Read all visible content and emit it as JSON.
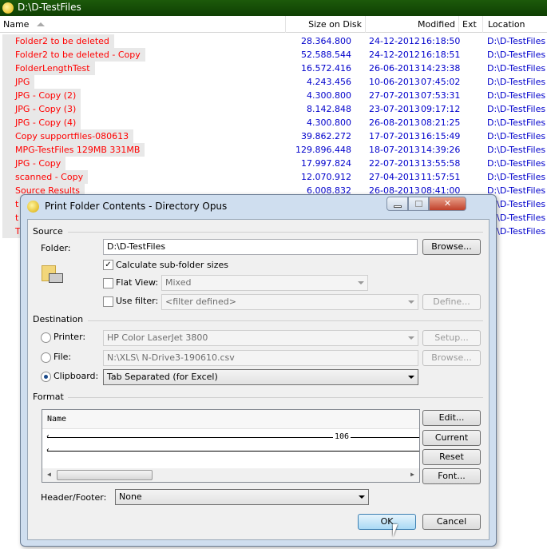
{
  "window": {
    "title": "D:\\D-TestFiles"
  },
  "columns": {
    "name": "Name",
    "size": "Size on Disk",
    "modified": "Modified",
    "ext": "Ext",
    "location": "Location"
  },
  "rows": [
    {
      "name": "Folder2 to be deleted",
      "size": "28.364.800",
      "date": "24-12-2012",
      "time": "16:18:50",
      "location": "D:\\D-TestFiles"
    },
    {
      "name": "Folder2 to be deleted - Copy",
      "size": "52.588.544",
      "date": "24-12-2012",
      "time": "16:18:51",
      "location": "D:\\D-TestFiles"
    },
    {
      "name": "FolderLengthTest",
      "size": "16.572.416",
      "date": "26-06-2013",
      "time": "14:23:38",
      "location": "D:\\D-TestFiles"
    },
    {
      "name": "JPG",
      "size": "4.243.456",
      "date": "10-06-2013",
      "time": "07:45:02",
      "location": "D:\\D-TestFiles"
    },
    {
      "name": "JPG - Copy (2)",
      "size": "4.300.800",
      "date": "27-07-2013",
      "time": "07:53:31",
      "location": "D:\\D-TestFiles"
    },
    {
      "name": "JPG - Copy (3)",
      "size": "8.142.848",
      "date": "23-07-2013",
      "time": "09:17:12",
      "location": "D:\\D-TestFiles"
    },
    {
      "name": "JPG - Copy (4)",
      "size": "4.300.800",
      "date": "26-08-2013",
      "time": "08:21:25",
      "location": "D:\\D-TestFiles"
    },
    {
      "name": "Copy supportfiles-080613",
      "size": "39.862.272",
      "date": "17-07-2013",
      "time": "16:15:49",
      "location": "D:\\D-TestFiles"
    },
    {
      "name": "MPG-TestFiles 129MB 331MB",
      "size": "129.896.448",
      "date": "18-07-2013",
      "time": "14:39:26",
      "location": "D:\\D-TestFiles"
    },
    {
      "name": "JPG - Copy",
      "size": "17.997.824",
      "date": "22-07-2013",
      "time": "13:55:58",
      "location": "D:\\D-TestFiles"
    },
    {
      "name": "scanned - Copy",
      "size": "12.070.912",
      "date": "27-04-2013",
      "time": "11:57:51",
      "location": "D:\\D-TestFiles"
    },
    {
      "name": "Source Results",
      "size": "6.008.832",
      "date": "26-08-2013",
      "time": "08:41:00",
      "location": "D:\\D-TestFiles"
    },
    {
      "name": "t",
      "size": "",
      "date": "",
      "time": "",
      "location": "D:\\D-TestFiles"
    },
    {
      "name": "t",
      "size": "",
      "date": "",
      "time": "",
      "location": "D:\\D-TestFiles"
    },
    {
      "name": "T",
      "size": "",
      "date": "",
      "time": "",
      "location": "D:\\D-TestFiles"
    }
  ],
  "dialog": {
    "title": "Print Folder Contents - Directory Opus",
    "source": {
      "heading": "Source",
      "folder_label": "Folder:",
      "folder_value": "D:\\D-TestFiles",
      "browse": "Browse...",
      "calc_subfolder": "Calculate sub-folder sizes",
      "calc_checked": true,
      "flat_view": "Flat View:",
      "flat_value": "Mixed",
      "use_filter": "Use filter:",
      "filter_value": "<filter defined>",
      "define": "Define..."
    },
    "destination": {
      "heading": "Destination",
      "printer_label": "Printer:",
      "printer_value": "HP Color LaserJet 3800",
      "setup": "Setup...",
      "file_label": "File:",
      "file_value": "N:\\XLS\\ N-Drive3-190610.csv",
      "browse": "Browse...",
      "clipboard_label": "Clipboard:",
      "clipboard_value": "Tab Separated (for Excel)",
      "selected": "clipboard"
    },
    "format": {
      "heading": "Format",
      "column_name": "Name",
      "width_value": "106",
      "edit": "Edit...",
      "current": "Current",
      "reset": "Reset",
      "font": "Font..."
    },
    "header_footer_label": "Header/Footer:",
    "header_footer_value": "None",
    "ok": "OK",
    "cancel": "Cancel"
  }
}
